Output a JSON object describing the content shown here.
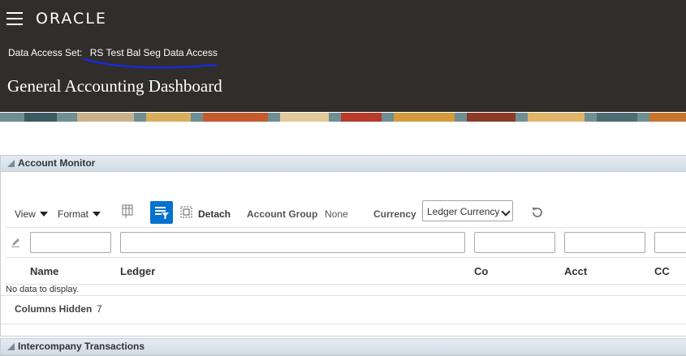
{
  "header": {
    "logo": "ORACLE",
    "data_access_label": "Data Access Set:",
    "data_access_value": "RS Test Bal Seg Data Access",
    "page_title": "General Accounting Dashboard"
  },
  "account_monitor": {
    "title": "Account Monitor",
    "toolbar": {
      "view_label": "View",
      "format_label": "Format",
      "detach_label": "Detach",
      "account_group_label": "Account Group",
      "account_group_value": "None",
      "currency_label": "Currency",
      "currency_value": "Ledger Currency"
    },
    "columns": [
      "Name",
      "Ledger",
      "Co",
      "Acct",
      "CC"
    ],
    "no_data": "No data to display.",
    "columns_hidden_label": "Columns Hidden",
    "columns_hidden_count": "7"
  },
  "intercompany": {
    "title": "Intercompany Transactions"
  },
  "colors": {
    "header_bg": "#312d2a",
    "accent_blue": "#0572ce",
    "underline_annotation": "#1a2bd8"
  }
}
